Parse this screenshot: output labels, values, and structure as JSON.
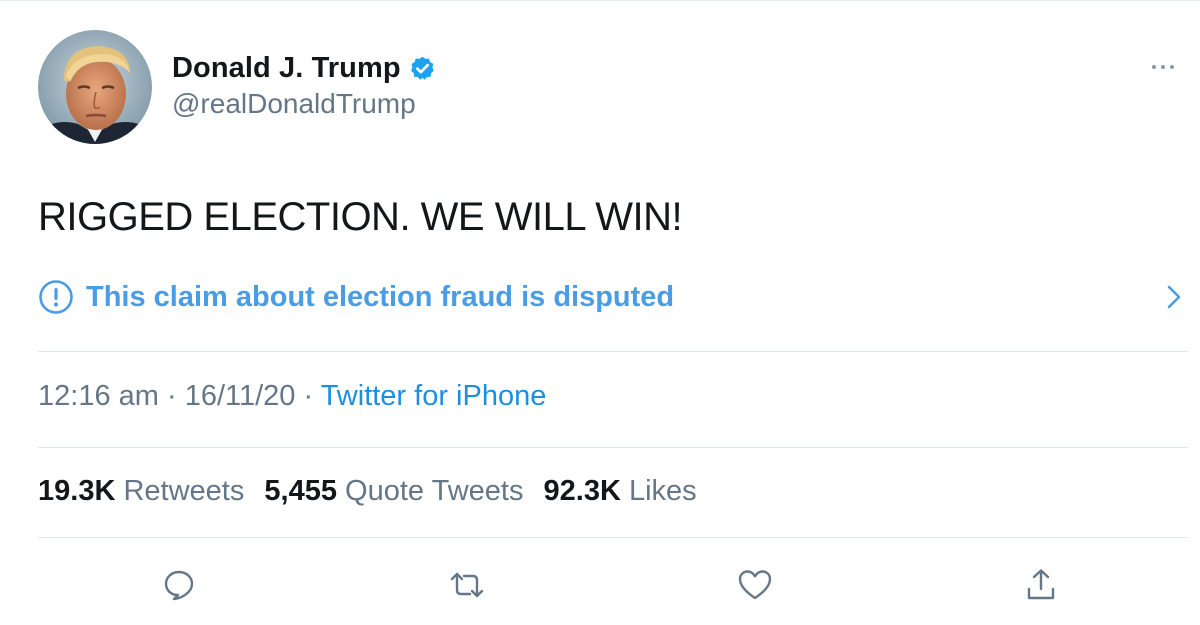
{
  "author": {
    "display_name": "Donald J. Trump",
    "handle": "@realDonaldTrump",
    "verified": true,
    "avatar_icon": "profile-photo"
  },
  "tweet": {
    "text": "RIGGED ELECTION. WE WILL WIN!"
  },
  "notice": {
    "text": "This claim about election fraud is disputed",
    "icon": "exclamation-circle-icon",
    "color": "#4a9de4"
  },
  "meta": {
    "time": "12:16 am",
    "separator": " · ",
    "date": "16/11/20",
    "source": "Twitter for iPhone"
  },
  "stats": {
    "retweets_count": "19.3K",
    "retweets_label": "Retweets",
    "quotes_count": "5,455",
    "quotes_label": "Quote Tweets",
    "likes_count": "92.3K",
    "likes_label": "Likes"
  },
  "actions": [
    "reply-icon",
    "retweet-icon",
    "like-icon",
    "share-icon"
  ],
  "colors": {
    "link_blue": "#1d8fe0",
    "verified_blue": "#1da1f2",
    "secondary_text": "#657786",
    "icon_gray": "#657786"
  }
}
